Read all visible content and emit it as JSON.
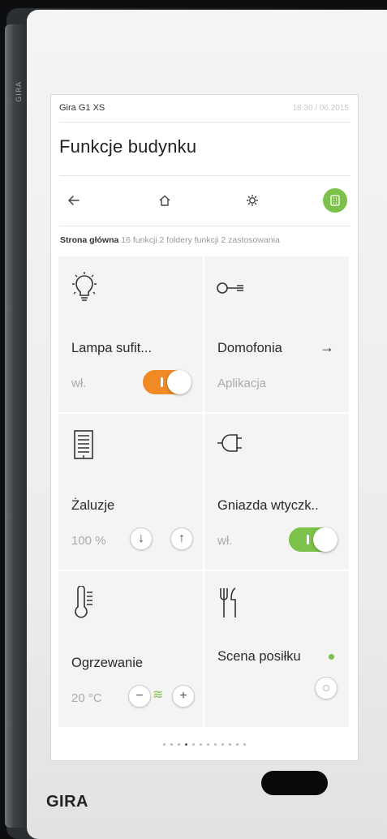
{
  "device": {
    "edge_text": "GIRA",
    "logo": "GIRA"
  },
  "status_bar": {
    "device_name": "Gira G1 XS",
    "time": "18:30 / 06.2015"
  },
  "page_title": "Funkcje budynku",
  "nav": {
    "items": [
      {
        "name": "back",
        "icon": "arrow-left-icon",
        "active": false
      },
      {
        "name": "home",
        "icon": "home-icon",
        "active": false
      },
      {
        "name": "settings",
        "icon": "gear-icon",
        "active": false
      },
      {
        "name": "functions",
        "icon": "grid-icon",
        "active": true
      }
    ],
    "active_color": "#7cc24a"
  },
  "breadcrumb": {
    "main": "Strona główna",
    "rest": "16 funkcji 2 foldery funkcji 2 zastosowania"
  },
  "tiles": [
    {
      "label": "Lampa sufit...",
      "status": "wł.",
      "icon": "light-bulb-icon",
      "control": "toggle",
      "toggle_on": true,
      "toggle_color": "#f08a24"
    },
    {
      "label": "Domofonia",
      "status": "Aplikacja",
      "icon": "key-icon",
      "control": "arrow",
      "arrow": "→"
    },
    {
      "label": "Żaluzje",
      "status": "100 %",
      "icon": "blind-icon",
      "control": "up-down",
      "down": "↓",
      "up": "↑"
    },
    {
      "label": "Gniazda wtyczk..",
      "status": "wł.",
      "icon": "plug-icon",
      "control": "toggle",
      "toggle_on": true,
      "toggle_color": "#7cc24a"
    },
    {
      "label": "Ogrzewanie",
      "status": "20 °C",
      "icon": "thermometer-icon",
      "control": "plus-minus",
      "minus": "−",
      "plus": "+",
      "heat_glyph": "≋"
    },
    {
      "label": "Scena posiłku",
      "status": "",
      "icon": "cutlery-icon",
      "control": "scene-button",
      "indicator_color": "#7cc24a"
    }
  ],
  "pager": {
    "count": 12,
    "active_index": 3
  }
}
